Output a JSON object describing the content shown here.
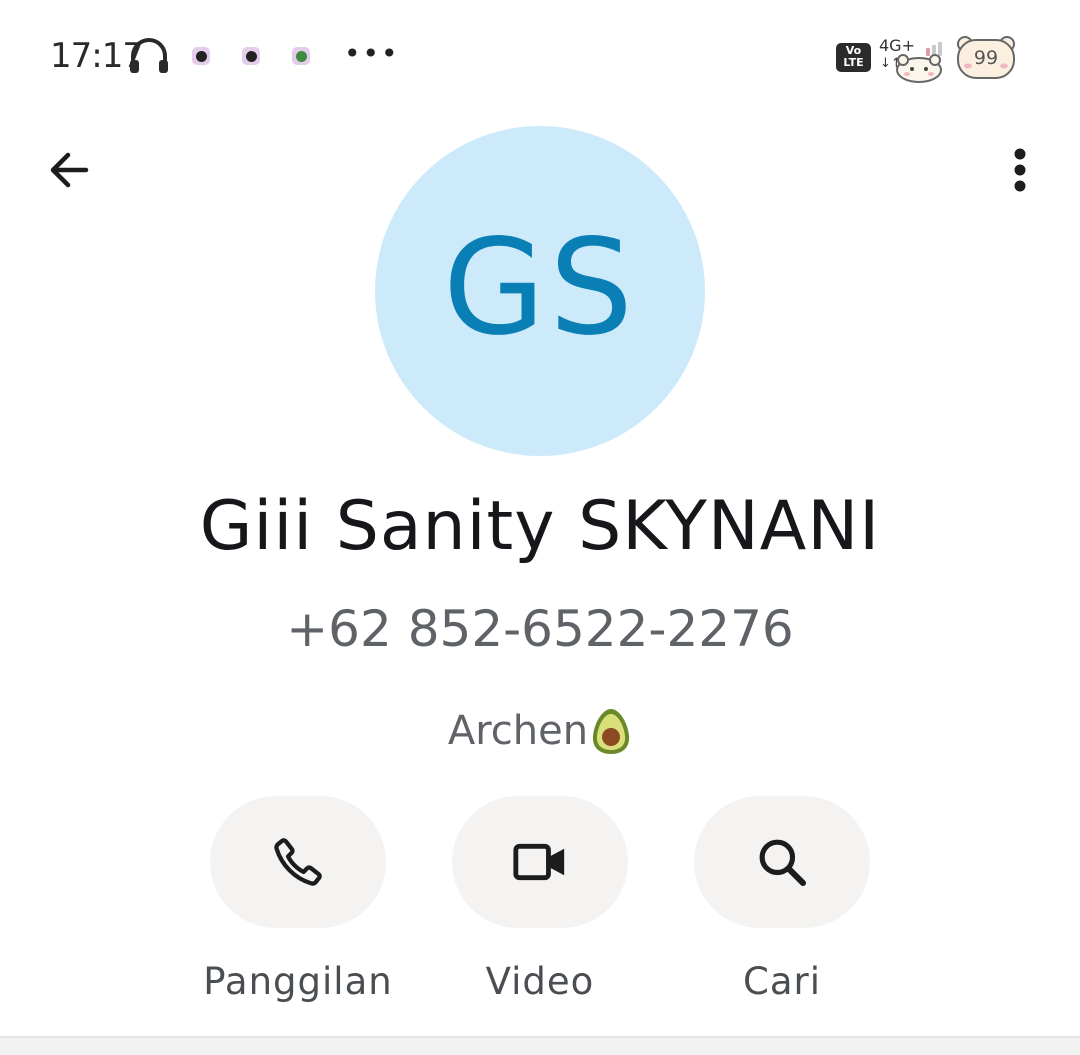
{
  "status_bar": {
    "time": "17:17",
    "more_indicator": "•••",
    "volte_line1": "Vo",
    "volte_line2": "LTE",
    "network_type": "4G+",
    "network_arrows": "↓↑",
    "battery_level": "99",
    "icons": [
      "headset-icon",
      "x-app-icon",
      "tiktok-icon",
      "game-app-icon",
      "signal-bear-icon",
      "battery-bear-icon"
    ]
  },
  "app_bar": {
    "back_icon": "arrow-back-icon",
    "more_icon": "more-vert-icon"
  },
  "contact": {
    "initials": "GS",
    "name": "Giii Sanity SKYNANI",
    "phone": "+62 852-6522-2276",
    "organization": "Archen",
    "organization_emoji": "avocado-icon",
    "avatar_color": "#cdeafa",
    "initials_color": "#0a7fb5"
  },
  "actions": [
    {
      "label": "Panggilan",
      "icon": "phone-icon"
    },
    {
      "label": "Video",
      "icon": "video-camera-icon"
    },
    {
      "label": "Cari",
      "icon": "search-icon"
    }
  ]
}
